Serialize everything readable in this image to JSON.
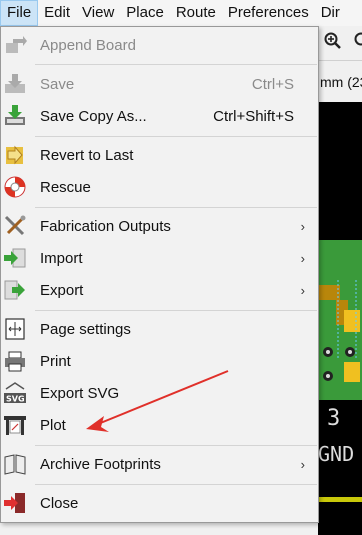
{
  "menubar": {
    "items": [
      "File",
      "Edit",
      "View",
      "Place",
      "Route",
      "Preferences",
      "Dir"
    ]
  },
  "status": {
    "text": "mm (23"
  },
  "canvas": {
    "silk_number": "3",
    "silk_net": "GND"
  },
  "file_menu": {
    "append_board": "Append Board",
    "save": "Save",
    "save_shortcut": "Ctrl+S",
    "save_copy_as": "Save Copy As...",
    "save_copy_as_shortcut": "Ctrl+Shift+S",
    "revert": "Revert to Last",
    "rescue": "Rescue",
    "fabrication_outputs": "Fabrication Outputs",
    "import": "Import",
    "export": "Export",
    "page_settings": "Page settings",
    "print": "Print",
    "export_svg": "Export SVG",
    "plot": "Plot",
    "archive_footprints": "Archive Footprints",
    "close": "Close",
    "submenu_arrow": "›"
  },
  "colors": {
    "menu_bg": "#f2f2f2",
    "active_menu": "#cce4f7",
    "annotation_arrow": "#e0302a",
    "pcb_green": "#3a9a3a"
  }
}
